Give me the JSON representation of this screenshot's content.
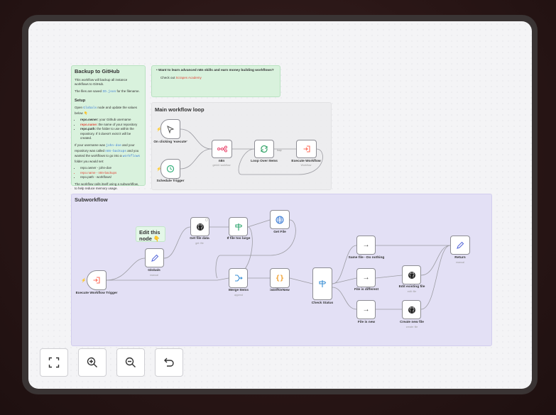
{
  "sticky_backup": {
    "title": "Backup to GitHub",
    "p1": "This workflow will backup all instance workflows to GitHub.",
    "p2a": "The files are saved ",
    "p2code": "ID.json",
    "p2b": " for the filename.",
    "setup": "Setup",
    "p3a": "Open ",
    "p3code": "Globals",
    "p3b": " node and update the values below 👇",
    "li1b": "repo.owner:",
    "li1": " your Github username",
    "li2b": "repo.name:",
    "li2": " the name of your repository",
    "li3b": "repo.path:",
    "li3": " the folder to use within the repository. If it doesn't exist it will be created.",
    "p4a": "If your username was ",
    "p4code1": "john-doe",
    "p4b": " and your repository was called ",
    "p4code2": "n8n-backups",
    "p4c": " and you wanted the workflows to go into a ",
    "p4code3": "workflows",
    "p4d": " folder you would set:",
    "ex1": "repo.owner - john-doe",
    "ex2": "repo.name - n8n-backups",
    "ex3": "repo.path - workflows/",
    "p5": "The workflow calls itself using a subworkflow, to help reduce memory usage."
  },
  "sticky_promo": {
    "title": "Want to learn advanced n8n skills and earn money building workflows?",
    "text": "Check out ",
    "link": "Scrapes Academy"
  },
  "main_loop": {
    "title": "Main workflow loop",
    "nodes": {
      "manual": {
        "label": "On clicking 'execute'"
      },
      "schedule": {
        "label": "Schedule Trigger"
      },
      "n8n": {
        "label": "n8n",
        "sub": "getAll: workflow"
      },
      "loop": {
        "label": "Loop Over Items"
      },
      "execute": {
        "label": "Execute Workflow",
        "sub": "Workflow"
      }
    },
    "edge_labels": {
      "done": "done",
      "loop": "loop"
    }
  },
  "subworkflow": {
    "title": "Subworkflow",
    "note": "Edit this node 👇",
    "nodes": {
      "exec_trigger": {
        "label": "Execute Workflow Trigger"
      },
      "globals": {
        "label": "Globals",
        "sub": "manual"
      },
      "get_file_data": {
        "label": "Get file data",
        "sub": "get: file"
      },
      "if_too_large": {
        "label": "If file too large"
      },
      "get_file": {
        "label": "Get File"
      },
      "merge": {
        "label": "Merge Items",
        "sub": "append"
      },
      "is_diff": {
        "label": "isDiffOrNew"
      },
      "check_status": {
        "label": "Check Status"
      },
      "same_file": {
        "label": "Same file - Do nothing"
      },
      "file_diff": {
        "label": "File is different"
      },
      "file_new": {
        "label": "File is new"
      },
      "edit_file": {
        "label": "Edit existing file",
        "sub": "edit: file"
      },
      "create_file": {
        "label": "Create new file",
        "sub": "create: file"
      },
      "return": {
        "label": "Return",
        "sub": "manual"
      }
    },
    "edge_labels": {
      "true": "true",
      "false": "false"
    }
  },
  "controls": [
    {
      "name": "zoom-to-fit-button",
      "icon": "fit-view-icon"
    },
    {
      "name": "zoom-in-button",
      "icon": "zoom-in-icon"
    },
    {
      "name": "zoom-out-button",
      "icon": "zoom-out-icon"
    },
    {
      "name": "undo-button",
      "icon": "undo-icon"
    }
  ],
  "colors": {
    "sticky_green": "#d9f2dd",
    "group_purple": "#e3e0f5",
    "trigger_orange": "#ff6d5a",
    "set_blue": "#5a6cdb",
    "loop_green": "#3aa76d",
    "if_green": "#2aa36b",
    "globe_blue": "#3a7bd5",
    "code_orange": "#f0a030",
    "merge_blue": "#3a8fd5",
    "clock_green": "#35b07c",
    "github_black": "#222222"
  }
}
